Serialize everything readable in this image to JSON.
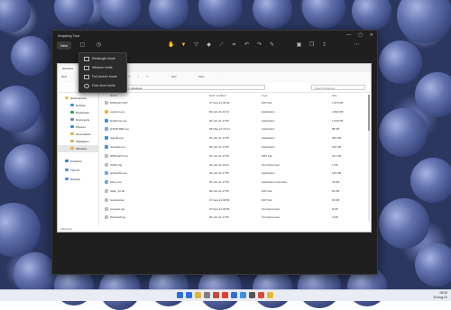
{
  "snipping_tool": {
    "title": "Snipping Tool",
    "new_label": "New",
    "window_controls": [
      "—",
      "▢",
      "✕"
    ],
    "modes": [
      "Rectangle mode",
      "Window mode",
      "Full-screen mode",
      "Free-form mode"
    ]
  },
  "explorer": {
    "tab_title": "Windows",
    "commands": [
      "New",
      "Sort",
      "View",
      "..."
    ],
    "address": "›  This PC  ›  Local Disk (C:)  ›  Windows",
    "search_placeholder": "Search Windows",
    "nav": [
      {
        "label": "Quick access",
        "color": "#f0c040"
      },
      {
        "label": "Desktop",
        "color": "#3d8fe0"
      },
      {
        "label": "Downloads",
        "color": "#2f9e5b"
      },
      {
        "label": "Documents",
        "color": "#6a86b8"
      },
      {
        "label": "Pictures",
        "color": "#3b87d8"
      },
      {
        "label": "Screenshots",
        "color": "#e0b33a"
      },
      {
        "label": "Wallpapers",
        "color": "#e0b33a"
      },
      {
        "label": "Windows",
        "color": "#e0b33a"
      },
      {
        "label": "OneDrive",
        "color": "#2d7fd8"
      },
      {
        "label": "This PC",
        "color": "#4c8fd8"
      },
      {
        "label": "Network",
        "color": "#4c8fd8"
      }
    ],
    "headers": [
      "Name",
      "Date modified",
      "Type",
      "Size"
    ],
    "files": [
      {
        "name": "WMSysPr.DAT",
        "date": "27-Sep-21 03:59",
        "type": "DAT File",
        "size": "1,576 KB",
        "color": "#bbbbbb"
      },
      {
        "name": "explorer.exe",
        "date": "09-Jun-21 22:16",
        "type": "Application",
        "size": "4,492 KB",
        "color": "#e8b830"
      },
      {
        "name": "HelpPane.exe",
        "date": "05-Jun-21 17:55",
        "type": "Application",
        "size": "1,040 KB",
        "color": "#3d8fe0"
      },
      {
        "name": "HVMTHMR.exe",
        "date": "05-May-21 10:14",
        "type": "Application",
        "size": "98 KB",
        "color": "#6fa8dc"
      },
      {
        "name": "regedit.exe",
        "date": "05-Jun-21 17:55",
        "type": "Application",
        "size": "355 KB",
        "color": "#3d8fe0"
      },
      {
        "name": "notepad.exe",
        "date": "05-Jun-21 17:55",
        "type": "Application",
        "size": "194 KB",
        "color": "#3d8fe0"
      },
      {
        "name": "WMSysPr9.prx",
        "date": "05-Jun-21 17:55",
        "type": "PRX File",
        "size": "317 KB",
        "color": "#bbbbbb"
      },
      {
        "name": "PFRO.log",
        "date": "06-Jun-21 10:42",
        "type": "Text Document",
        "size": "1 KB",
        "color": "#bbbbbb"
      },
      {
        "name": "splwow64.exe",
        "date": "05-Jun-21 17:55",
        "type": "Application",
        "size": "149 KB",
        "color": "#6fa8dc"
      },
      {
        "name": "bfsvc.exe",
        "date": "05-Jun-21 17:55",
        "type": "Application extension",
        "size": "78 KB",
        "color": "#6fa8dc"
      },
      {
        "name": "twain_32.dll",
        "date": "05-Jun-21 17:55",
        "type": "DAT File",
        "size": "53 KB",
        "color": "#bbbbbb"
      },
      {
        "name": "bootstat.dat",
        "date": "27-Sep-21 03:59",
        "type": "DAT File",
        "size": "66 KB",
        "color": "#bbbbbb"
      },
      {
        "name": "setupact.log",
        "date": "27-Sep-21 03:59",
        "type": "Text Document",
        "size": "8 KB",
        "color": "#bbbbbb"
      },
      {
        "name": "DtcInstall.log",
        "date": "05-Jun-21 17:55",
        "type": "Text Document",
        "size": "2 KB",
        "color": "#bbbbbb"
      }
    ],
    "status": "116 items"
  },
  "taskbar": {
    "icons": [
      "#2d6fd8",
      "#2d6fd8",
      "#e0b33a",
      "#7e7e7e",
      "#c34a36",
      "#e63b2e",
      "#2a6fd8",
      "#3d8fe0",
      "#555555",
      "#d84a3a",
      "#e8b830"
    ],
    "time": "08:50",
    "date": "10-Aug-21"
  }
}
